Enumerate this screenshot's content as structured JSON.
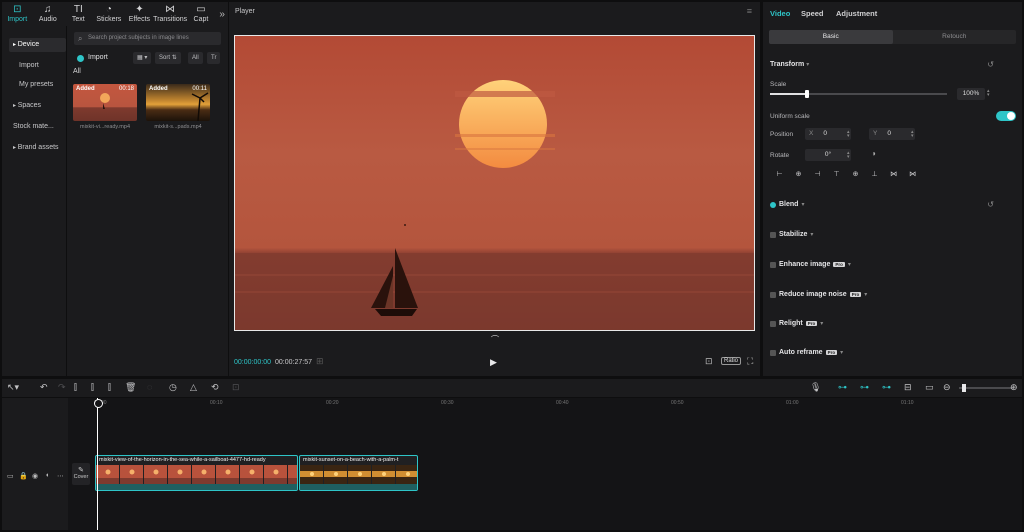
{
  "tools": [
    {
      "label": "Import",
      "icon": "import-icon",
      "glyph": "⊡",
      "active": true
    },
    {
      "label": "Audio",
      "icon": "audio-icon",
      "glyph": "♫"
    },
    {
      "label": "Text",
      "icon": "text-icon",
      "glyph": "TI"
    },
    {
      "label": "Stickers",
      "icon": "stickers-icon",
      "glyph": "◔"
    },
    {
      "label": "Effects",
      "icon": "effects-icon",
      "glyph": "✦"
    },
    {
      "label": "Transitions",
      "icon": "transitions-icon",
      "glyph": "⋈"
    },
    {
      "label": "Capt",
      "icon": "captions-icon",
      "glyph": "▭"
    }
  ],
  "nav": [
    "Device",
    "Import",
    "My presets",
    "Spaces",
    "Stock mate...",
    "Brand assets"
  ],
  "media": {
    "search_placeholder": "Search project subjects in image lines",
    "import_label": "Import",
    "sort_label": "Sort",
    "all_label": "All",
    "filter_all": "All",
    "items": [
      {
        "added": "Added",
        "duration": "00:18",
        "name": "mixkit-vi...ready.mp4"
      },
      {
        "added": "Added",
        "duration": "00:11",
        "name": "mixkit-s...pads.mp4"
      }
    ]
  },
  "player": {
    "title": "Player",
    "time_current": "00:00:00:00",
    "time_total": "00:00:27:57",
    "ratio_label": "Ratio"
  },
  "inspector": {
    "tabs": [
      "Video",
      "Speed",
      "Adjustment"
    ],
    "segments": [
      "Basic",
      "Retouch"
    ],
    "transform_title": "Transform",
    "scale_label": "Scale",
    "scale_value": "100%",
    "scale_fraction": 0.21,
    "uniform_scale_label": "Uniform scale",
    "position_label": "Position",
    "pos_x_prefix": "X",
    "pos_x": "0",
    "pos_y_prefix": "Y",
    "pos_y": "0",
    "rotate_label": "Rotate",
    "rotate_value": "0°",
    "align_glyphs": [
      "⊢",
      "⊕",
      "⊣",
      "⊤",
      "⊕",
      "⊥",
      "⋈",
      "⋈"
    ],
    "sections": [
      {
        "label": "Blend",
        "checked": true,
        "pro": false
      },
      {
        "label": "Stabilize",
        "checked": false,
        "pro": false
      },
      {
        "label": "Enhance image",
        "checked": false,
        "pro": true
      },
      {
        "label": "Reduce image noise",
        "checked": false,
        "pro": true
      },
      {
        "label": "Relight",
        "checked": false,
        "pro": true
      },
      {
        "label": "Auto reframe",
        "checked": false,
        "pro": true
      }
    ],
    "pro_label": "Pro"
  },
  "timeline": {
    "cover_label": "Cover",
    "ticks": [
      "00:00",
      "00:10",
      "00:20",
      "00:30",
      "00:40",
      "00:50",
      "01:00",
      "01:10"
    ],
    "clips": [
      {
        "name": "mixkit-view-of-the-horizon-in-the-sea-while-a-sailboat-4477-hd-ready",
        "kind": "sunset-red"
      },
      {
        "name": "mixkit-sunset-on-a-beach-with-a-palm-t",
        "kind": "sunset-gold"
      }
    ],
    "zoom_fraction": 0.05
  },
  "colors": {
    "accent": "#2ec5c8",
    "panel": "#1b1b1d",
    "background": "#0e0e0f"
  }
}
